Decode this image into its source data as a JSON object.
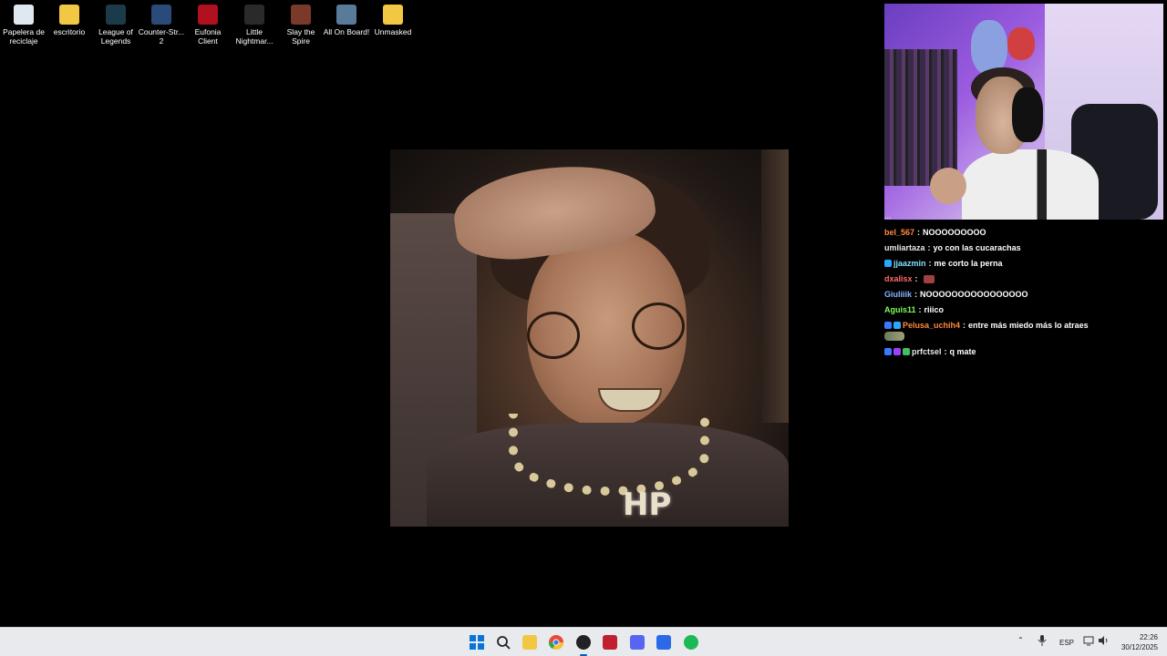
{
  "desktop": {
    "icons": [
      {
        "label": "Papelera de reciclaje",
        "icon": "recycle-bin-icon",
        "color": "#dfe8f0"
      },
      {
        "label": "escritorio",
        "icon": "folder-icon",
        "color": "#f2c744"
      },
      {
        "label": "League of Legends",
        "icon": "league-of-legends-icon",
        "color": "#1b3a4a"
      },
      {
        "label": "Counter-Str... 2",
        "icon": "counter-strike-icon",
        "color": "#2a4a7a"
      },
      {
        "label": "Eufonia Client",
        "icon": "eufonia-icon",
        "color": "#b01020"
      },
      {
        "label": "Little Nightmar...",
        "icon": "little-nightmares-icon",
        "color": "#2a2a2a"
      },
      {
        "label": "Slay the Spire",
        "icon": "slay-the-spire-icon",
        "color": "#7a3a2a"
      },
      {
        "label": "All On Board!",
        "icon": "all-on-board-icon",
        "color": "#5a7a9a"
      },
      {
        "label": "Unmasked",
        "icon": "folder-icon",
        "color": "#f2c744"
      }
    ]
  },
  "center_image": {
    "pendant_text": "HP"
  },
  "chat": {
    "cut_message": "...",
    "messages": [
      {
        "user": "bel_567",
        "user_color": "#ff8a3d",
        "text": "NOOOOOOOOO",
        "badges": []
      },
      {
        "user": "umliartaza",
        "user_color": "#e8e8e8",
        "text": "yo con las cucarachas",
        "badges": []
      },
      {
        "user": "jjaazmin",
        "user_color": "#7fe0ff",
        "text": "me corto la perna",
        "badges": [
          "#2aa8ff"
        ]
      },
      {
        "user": "dxalisx",
        "user_color": "#ff6a6a",
        "text": "",
        "badges": [],
        "emote": "#a04040"
      },
      {
        "user": "Giuliiik",
        "user_color": "#8ab4ff",
        "text": "NOOOOOOOOOOOOOOOO",
        "badges": []
      },
      {
        "user": "Aguis11",
        "user_color": "#7cff5a",
        "text": "riiico",
        "badges": []
      },
      {
        "user": "Pelusa_uchih4",
        "user_color": "#ff8a3d",
        "text": "entre más miedo más lo atraes",
        "badges": [
          "#3a7aff",
          "#2aa8ff"
        ]
      },
      {
        "user": "prfctsel",
        "user_color": "#e8e8e8",
        "text": "q mate",
        "badges": [
          "#3a7aff",
          "#a040ff",
          "#40c060"
        ]
      }
    ]
  },
  "taskbar": {
    "apps": [
      {
        "name": "start",
        "icon": "windows-start-icon",
        "color": "#0a74d8"
      },
      {
        "name": "search",
        "icon": "search-icon",
        "color": "#222222"
      },
      {
        "name": "file-explorer",
        "icon": "folder-icon",
        "color": "#f2c744"
      },
      {
        "name": "chrome",
        "icon": "chrome-icon",
        "color": "#e84a3a"
      },
      {
        "name": "obs",
        "icon": "obs-icon",
        "color": "#222222",
        "active": true
      },
      {
        "name": "streamdeck",
        "icon": "stream-app-icon",
        "color": "#c02030"
      },
      {
        "name": "discord",
        "icon": "discord-icon",
        "color": "#5865f2"
      },
      {
        "name": "app-blue",
        "icon": "blue-app-icon",
        "color": "#2a6ae8"
      },
      {
        "name": "spotify",
        "icon": "spotify-icon",
        "color": "#1db954"
      }
    ],
    "tray": {
      "language": "ESP",
      "time": "22:26",
      "date": "30/12/2025"
    }
  }
}
